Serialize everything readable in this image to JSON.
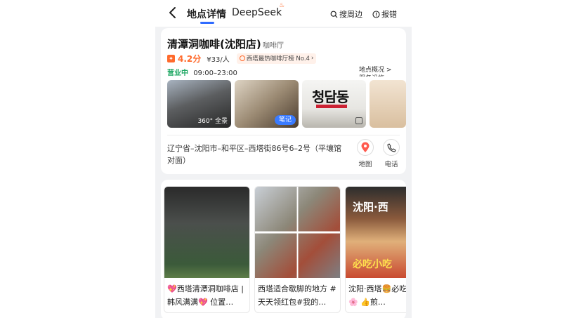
{
  "nav": {
    "tab_detail": "地点详情",
    "tab_deepseek": "DeepSeek",
    "search_nearby": "搜周边",
    "report_error": "报错"
  },
  "place": {
    "name": "清潭洞咖啡(沈阳店)",
    "category": "咖啡厅",
    "rating": "4.2分",
    "price": "¥33/人",
    "rank": "西塔最热咖啡厅榜 No.4",
    "status": "营业中",
    "hours": "09:00–23:00",
    "overview": "地点概况 >",
    "overview_cut": "服务设施 >",
    "address": "辽宁省–沈阳市–和平区–西塔街86号6–2号（平壤馆对面）",
    "map_label": "地图",
    "phone_label": "电话"
  },
  "photos": {
    "panorama": "全景",
    "note": "笔记",
    "brand_text": "청담동"
  },
  "notes": [
    {
      "title": "💖西塔清潭洞咖啡店 | 韩风满满💖 位置…"
    },
    {
      "title": "西塔适合歇脚的地方 #天天领红包#我的…"
    },
    {
      "title": "沈阳·西塔🍔必吃合集🌸 👍煎…",
      "img_title": "沈阳·西",
      "img_sub": "必吃小吃"
    }
  ],
  "colors": {
    "accent": "#2f6bff",
    "rating": "#ff6a2c",
    "open": "#1ea763"
  }
}
